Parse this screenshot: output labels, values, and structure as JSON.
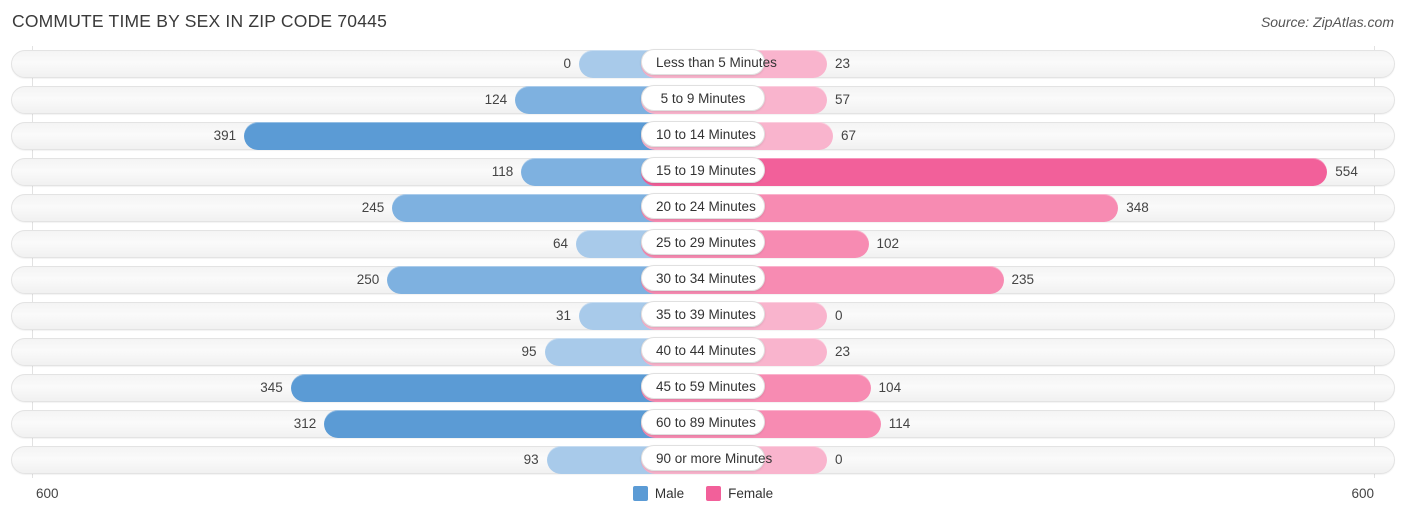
{
  "header": {
    "title": "COMMUTE TIME BY SEX IN ZIP CODE 70445",
    "source": "Source: ZipAtlas.com"
  },
  "axis": {
    "left_label": "600",
    "right_label": "600"
  },
  "legend": {
    "items": [
      {
        "label": "Male",
        "color": "#5b9bd5"
      },
      {
        "label": "Female",
        "color": "#f2609a"
      }
    ]
  },
  "colors": {
    "male_light": "#a8caea",
    "male_mid": "#7eb1e0",
    "male_strong": "#5b9bd5",
    "female_light": "#f9b4cd",
    "female_mid": "#f78bb2",
    "female_strong": "#f2609a",
    "track": "#f5f5f5",
    "grid": "#e2e2e2"
  },
  "chart_data": {
    "type": "bar",
    "title": "COMMUTE TIME BY SEX IN ZIP CODE 70445",
    "subtitle": "",
    "orientation": "horizontal-diverging",
    "xlabel": "",
    "ylabel": "",
    "xlim": [
      0,
      600
    ],
    "grid": true,
    "legend_position": "bottom-center",
    "categories": [
      "Less than 5 Minutes",
      "5 to 9 Minutes",
      "10 to 14 Minutes",
      "15 to 19 Minutes",
      "20 to 24 Minutes",
      "25 to 29 Minutes",
      "30 to 34 Minutes",
      "35 to 39 Minutes",
      "40 to 44 Minutes",
      "45 to 59 Minutes",
      "60 to 89 Minutes",
      "90 or more Minutes"
    ],
    "series": [
      {
        "name": "Male",
        "values": [
          0,
          124,
          391,
          118,
          245,
          64,
          250,
          31,
          95,
          345,
          312,
          93
        ]
      },
      {
        "name": "Female",
        "values": [
          23,
          57,
          67,
          554,
          348,
          102,
          235,
          0,
          23,
          104,
          114,
          0
        ]
      }
    ]
  },
  "rows": [
    {
      "label": "Less than 5 Minutes",
      "male": 0,
      "female": 23,
      "male_text": "0",
      "female_text": "23"
    },
    {
      "label": "5 to 9 Minutes",
      "male": 124,
      "female": 57,
      "male_text": "124",
      "female_text": "57"
    },
    {
      "label": "10 to 14 Minutes",
      "male": 391,
      "female": 67,
      "male_text": "391",
      "female_text": "67"
    },
    {
      "label": "15 to 19 Minutes",
      "male": 118,
      "female": 554,
      "male_text": "118",
      "female_text": "554"
    },
    {
      "label": "20 to 24 Minutes",
      "male": 245,
      "female": 348,
      "male_text": "245",
      "female_text": "348"
    },
    {
      "label": "25 to 29 Minutes",
      "male": 64,
      "female": 102,
      "male_text": "64",
      "female_text": "102"
    },
    {
      "label": "30 to 34 Minutes",
      "male": 250,
      "female": 235,
      "male_text": "250",
      "female_text": "235"
    },
    {
      "label": "35 to 39 Minutes",
      "male": 31,
      "female": 0,
      "male_text": "31",
      "female_text": "0"
    },
    {
      "label": "40 to 44 Minutes",
      "male": 95,
      "female": 23,
      "male_text": "95",
      "female_text": "23"
    },
    {
      "label": "45 to 59 Minutes",
      "male": 345,
      "female": 104,
      "male_text": "345",
      "female_text": "104"
    },
    {
      "label": "60 to 89 Minutes",
      "male": 312,
      "female": 114,
      "male_text": "312",
      "female_text": "114"
    },
    {
      "label": "90 or more Minutes",
      "male": 93,
      "female": 0,
      "male_text": "93",
      "female_text": "0"
    }
  ]
}
